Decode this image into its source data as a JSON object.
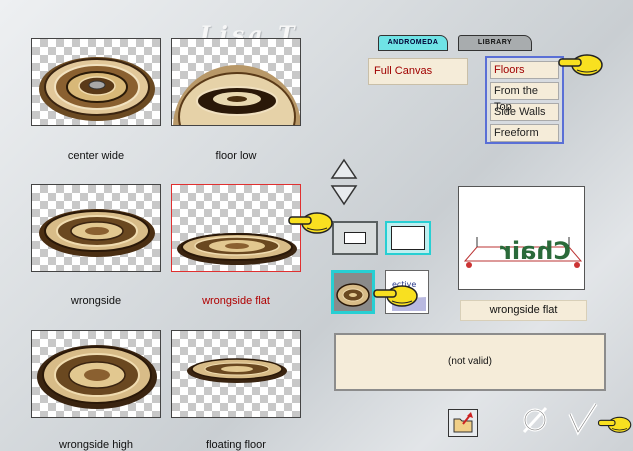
{
  "watermark": "Lisa T",
  "tabs": [
    "ANDROMEDA",
    "LIBRARY"
  ],
  "thumbnails": [
    {
      "label": "center wide",
      "selected": false
    },
    {
      "label": "floor low",
      "selected": false
    },
    {
      "label": "wrongside",
      "selected": false
    },
    {
      "label": "wrongside flat",
      "selected": true
    },
    {
      "label": "wrongside high",
      "selected": false
    },
    {
      "label": "floating floor",
      "selected": false
    }
  ],
  "canvas_option": "Full Canvas",
  "floor_options": [
    "Floors",
    "From the Top",
    "Side Walls",
    "Freeform"
  ],
  "selected_floor": "Floors",
  "preview": {
    "label": "wrongside flat",
    "mirrored_text": "Chair"
  },
  "status_message": "(not valid)",
  "icons": {
    "scroll_up": "chevron-up-icon",
    "scroll_down": "chevron-down-icon",
    "open_file": "folder-icon",
    "cancel": "cancel-icon",
    "ok": "check-icon",
    "pointer": "pointing-hand-icon"
  },
  "colors": {
    "accent": "#27cfd3",
    "selection_red": "#e03030",
    "panel_beige": "#f5ecd9",
    "list_border": "#5a6fd6"
  }
}
